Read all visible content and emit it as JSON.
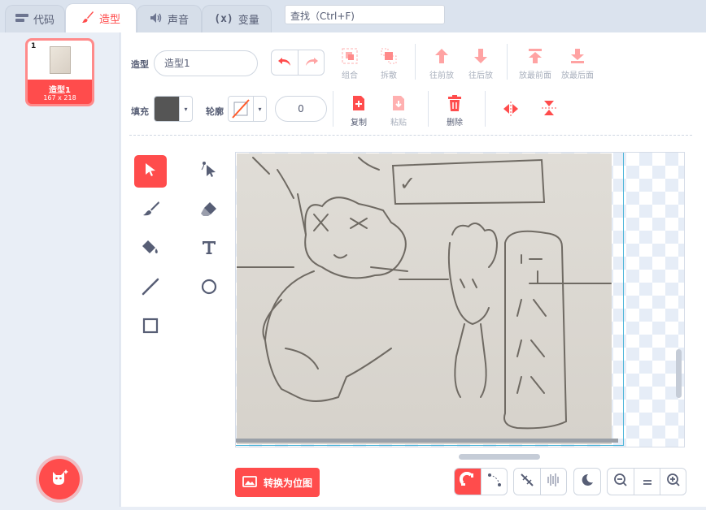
{
  "tabs": [
    {
      "label": "代码",
      "icon": "code-icon"
    },
    {
      "label": "造型",
      "icon": "brush-icon"
    },
    {
      "label": "声音",
      "icon": "speaker-icon"
    },
    {
      "label": "变量",
      "icon": "variable-icon"
    }
  ],
  "search": {
    "placeholder": "查找 (Ctrl+F)",
    "value": "查找（Ctrl+F)"
  },
  "costume_list": [
    {
      "index": "1",
      "name": "造型1",
      "size": "167 x 218"
    }
  ],
  "editor": {
    "costume_label": "造型",
    "costume_name": "造型1",
    "fill_label": "填充",
    "outline_label": "轮廓",
    "outline_width": "0",
    "fill_color": "#555555",
    "tools": {
      "group": "组合",
      "ungroup": "拆散",
      "forward": "往前放",
      "backward": "往后放",
      "front": "放最前面",
      "back": "放最后面",
      "copy": "复制",
      "paste": "粘贴",
      "delete": "删除"
    },
    "convert_bitmap": "转换为位图"
  },
  "colors": {
    "accent": "#ff4c4c",
    "text": "#575e75",
    "selection": "#4cb5d9"
  }
}
